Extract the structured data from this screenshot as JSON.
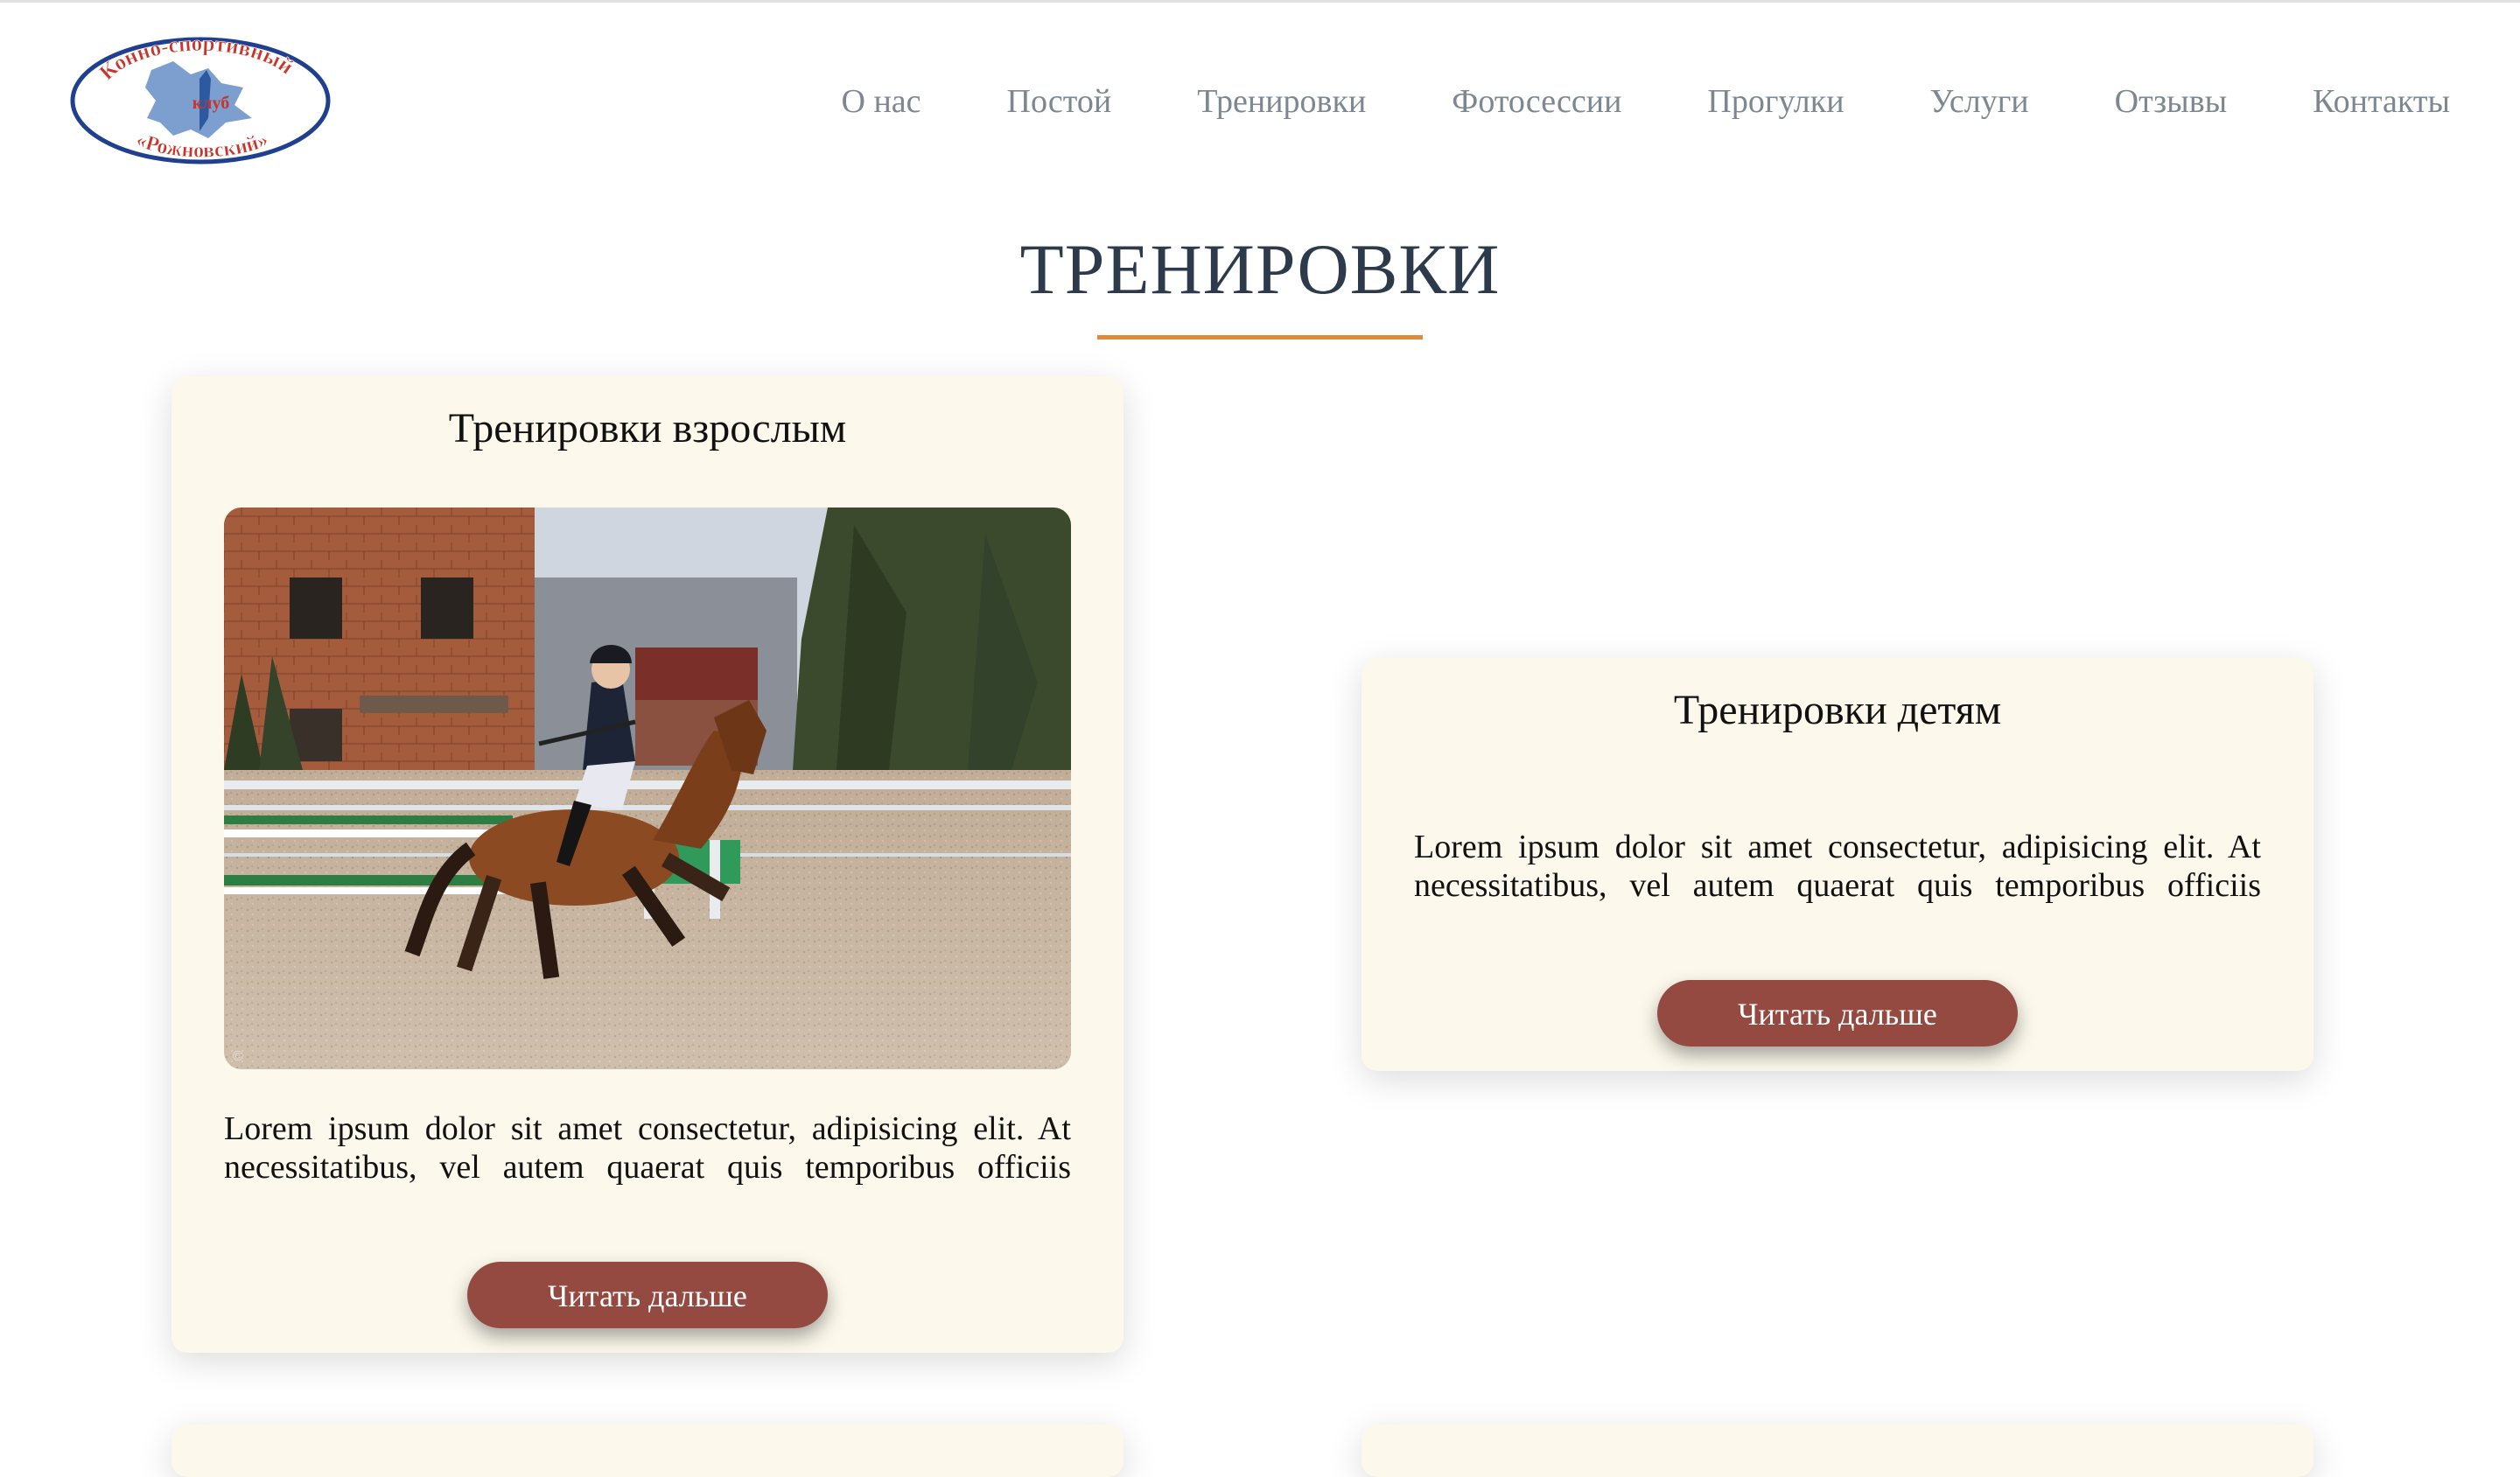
{
  "logo": {
    "line1": "Конно-спортивный",
    "line2": "клуб",
    "line3": "«Рожновский»"
  },
  "nav": {
    "items": [
      "О нас",
      "Постой",
      "Тренировки",
      "Фотосессии",
      "Прогулки",
      "Услуги",
      "Отзывы",
      "Контакты"
    ]
  },
  "section": {
    "title": "ТРЕНИРОВКИ"
  },
  "cards": [
    {
      "title": "Тренировки взрослым",
      "text": "Lorem ipsum dolor sit amet consectetur, adipisicing elit. At necessitatibus, vel autem quaerat quis temporibus officiis facere quod nulla obcaecati impedit porro provident",
      "button": "Читать дальше"
    },
    {
      "title": "Тренировки детям",
      "text": "Lorem ipsum dolor sit amet consectetur, adipisicing elit. At necessitatibus, vel autem quaerat quis temporibus officiis facere quod nulla obcaecati impedit porro provident",
      "button": "Читать дальше"
    }
  ],
  "colors": {
    "accent": "#e08a3c",
    "button": "#944a40",
    "card_bg": "#fcf9ec",
    "nav_text": "#7d8790",
    "title": "#2c3a4b"
  }
}
